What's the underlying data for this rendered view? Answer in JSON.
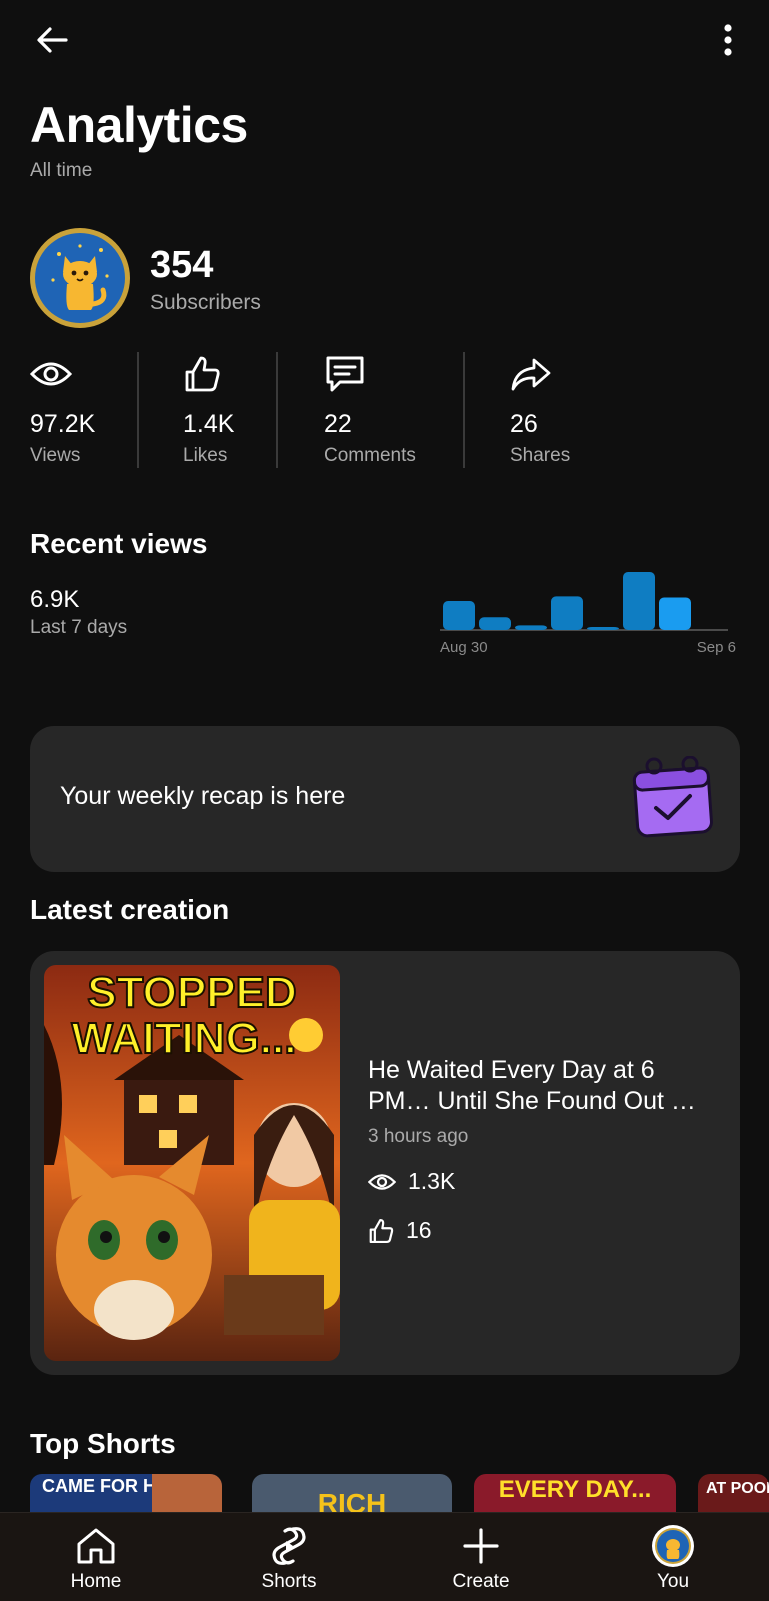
{
  "header": {
    "title": "Analytics",
    "subtitle": "All time"
  },
  "channel": {
    "subscriber_count": "354",
    "subscriber_label": "Subscribers"
  },
  "stats": [
    {
      "value": "97.2K",
      "label": "Views",
      "icon": "eye-icon"
    },
    {
      "value": "1.4K",
      "label": "Likes",
      "icon": "thumb-up-icon"
    },
    {
      "value": "22",
      "label": "Comments",
      "icon": "comment-icon"
    },
    {
      "value": "26",
      "label": "Shares",
      "icon": "share-icon"
    }
  ],
  "recent_views": {
    "title": "Recent views",
    "value": "6.9K",
    "period": "Last 7 days",
    "chart_start_label": "Aug 30",
    "chart_end_label": "Sep 6",
    "bar_values": [
      0.5,
      0.22,
      0.08,
      0.58,
      0.05,
      1.0,
      0.56
    ],
    "bar_color": "#0f7dc2",
    "highlight_color": "#1a9cf0"
  },
  "recap": {
    "text": "Your weekly recap is here",
    "icon": "calendar-check-icon",
    "icon_color": "#a56bf2"
  },
  "latest": {
    "section_title": "Latest creation",
    "thumbnail_text_line1": "STOPPED",
    "thumbnail_text_line2": "WAITING...",
    "video_title": "He Waited Every Day at 6 PM… Until She Found Out …",
    "time_ago": "3 hours ago",
    "views": "1.3K",
    "likes": "16"
  },
  "top_shorts": {
    "section_title": "Top Shorts",
    "items": [
      {
        "caption": "CAME FOR HELP!"
      },
      {
        "caption": "RICH"
      },
      {
        "caption": "EVERY DAY..."
      },
      {
        "caption": "AT POOR"
      }
    ]
  },
  "nav": [
    {
      "label": "Home",
      "icon": "home-icon"
    },
    {
      "label": "Shorts",
      "icon": "shorts-icon"
    },
    {
      "label": "Create",
      "icon": "plus-icon"
    },
    {
      "label": "You",
      "icon": "avatar-icon"
    }
  ]
}
